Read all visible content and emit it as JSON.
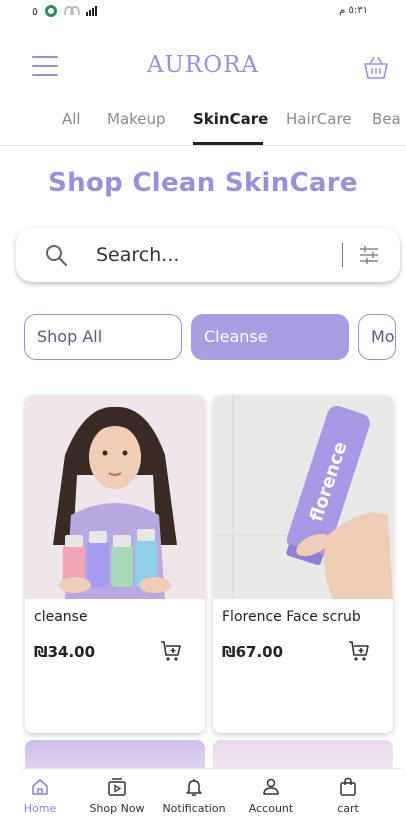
{
  "status_bar": {
    "time": "٥:٣١ م",
    "left_num": "٥"
  },
  "header": {
    "logo": "AURORA"
  },
  "categories": [
    "All",
    "Makeup",
    "SkinCare",
    "HairCare",
    "Bea"
  ],
  "headline": "Shop Clean SkinCare",
  "search": {
    "placeholder": "Search..."
  },
  "chips": [
    "Shop All",
    "Cleanse",
    "Mo"
  ],
  "products": [
    {
      "title": "cleanse",
      "price": "₪34.00"
    },
    {
      "title": "Florence Face scrub",
      "price": "₪67.00"
    }
  ],
  "bottom_nav": [
    {
      "label": "Home",
      "icon": "home-icon"
    },
    {
      "label": "Shop Now",
      "icon": "shop-now-icon"
    },
    {
      "label": "Notification",
      "icon": "bell-icon"
    },
    {
      "label": "Account",
      "icon": "account-icon"
    },
    {
      "label": "cart",
      "icon": "shopping-bag-icon"
    }
  ],
  "colors": {
    "accent": "#9c8fd8",
    "chip_active": "#a99ee2"
  }
}
